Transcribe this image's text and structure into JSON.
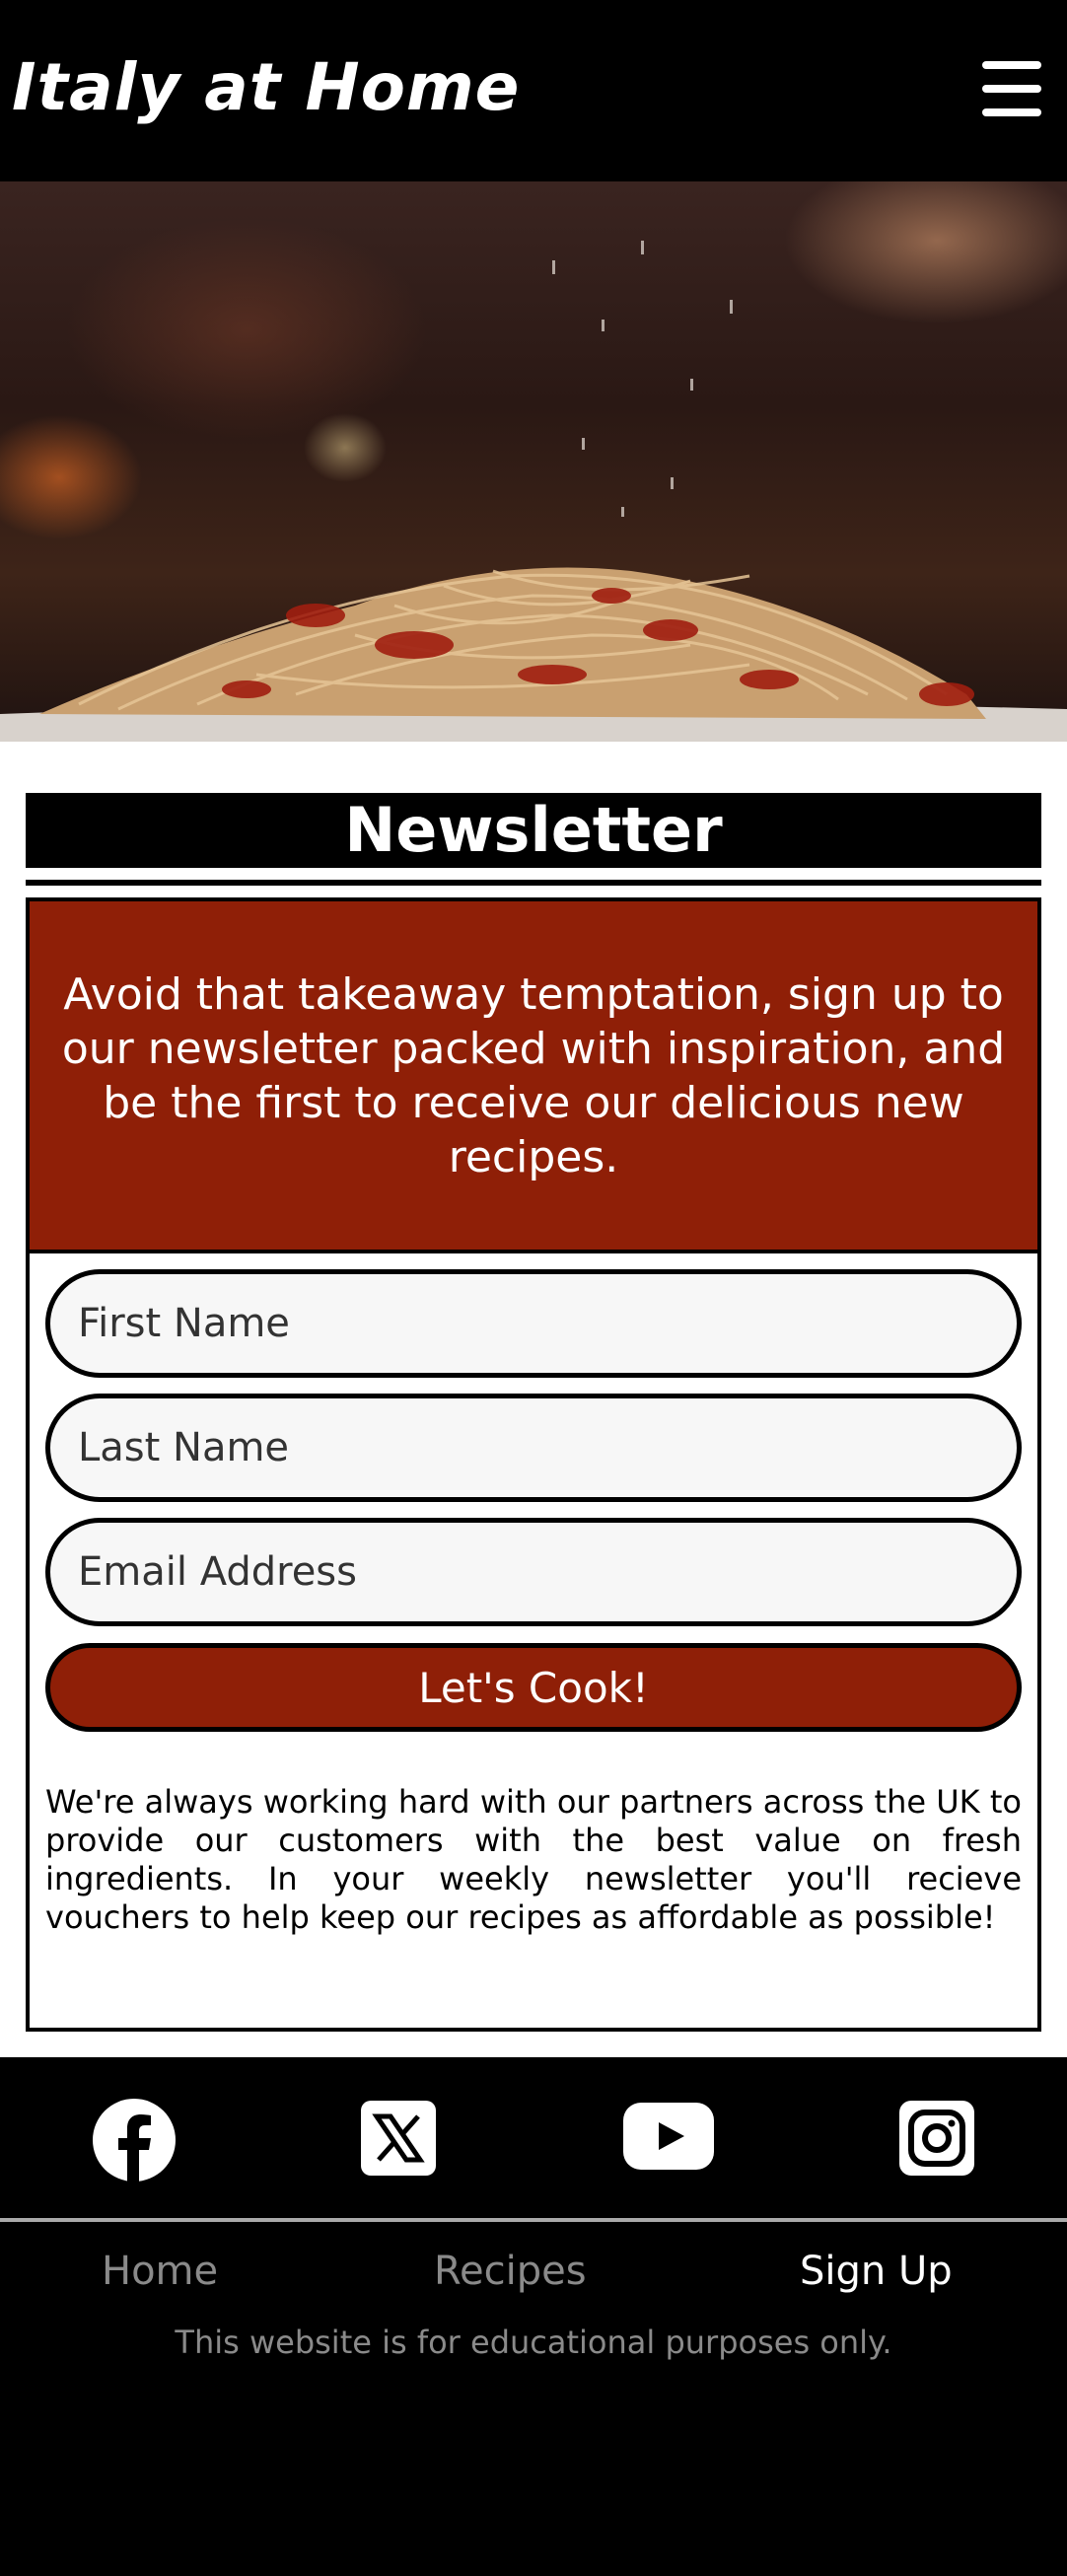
{
  "header": {
    "brand": "Italy at Home",
    "menu_icon": "hamburger-menu-icon"
  },
  "hero": {
    "image": "spaghetti-with-tomato-sauce-being-garnished"
  },
  "newsletter": {
    "title": "Newsletter",
    "intro": "Avoid that takeaway temptation, sign up to our newsletter packed with inspiration, and be the first to receive our delicious new recipes.",
    "fields": [
      {
        "placeholder": "First Name"
      },
      {
        "placeholder": "Last Name"
      },
      {
        "placeholder": "Email Address"
      }
    ],
    "submit_label": "Let's Cook!",
    "info": "We're always working hard with our partners across the UK to provide our customers with the best value on fresh ingredients. In your weekly newsletter you'll recieve vouchers to help keep our recipes as affordable as possible!"
  },
  "footer": {
    "social": [
      "facebook-icon",
      "x-twitter-icon",
      "youtube-icon",
      "instagram-icon"
    ],
    "nav": [
      {
        "label": "Home",
        "active": false
      },
      {
        "label": "Recipes",
        "active": false
      },
      {
        "label": "Sign Up",
        "active": true
      }
    ],
    "disclaimer": "This website is for educational purposes only."
  },
  "colors": {
    "accent": "#8f1f07",
    "header_bg": "#000000",
    "page_bg": "#ffffff",
    "muted_text": "#8a8a8a"
  }
}
